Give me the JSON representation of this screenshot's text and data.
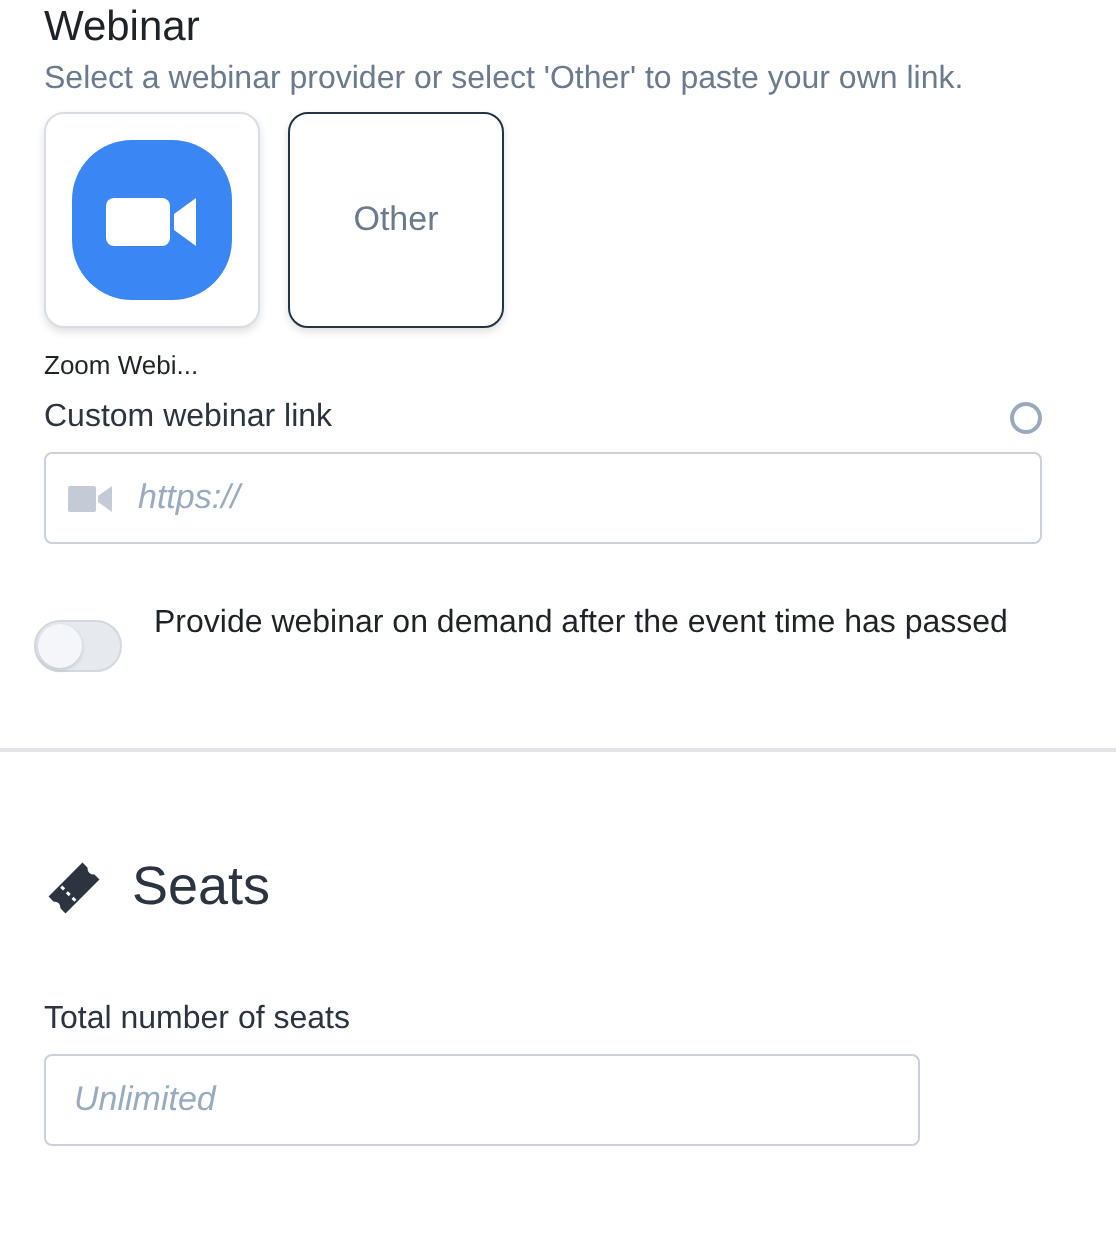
{
  "webinar": {
    "title": "Webinar",
    "description": "Select a webinar provider or select 'Other' to paste your own link.",
    "providers": [
      {
        "kind": "zoom",
        "label": "Zoom Webi...",
        "selected": false
      },
      {
        "kind": "other",
        "text": "Other",
        "selected": true
      }
    ],
    "custom_link": {
      "label": "Custom webinar link",
      "selected": false,
      "placeholder": "https://"
    },
    "on_demand": {
      "on": false,
      "label": "Provide webinar on demand after the event time has passed"
    }
  },
  "seats": {
    "title": "Seats",
    "field_label": "Total number of seats",
    "placeholder": "Unlimited"
  }
}
